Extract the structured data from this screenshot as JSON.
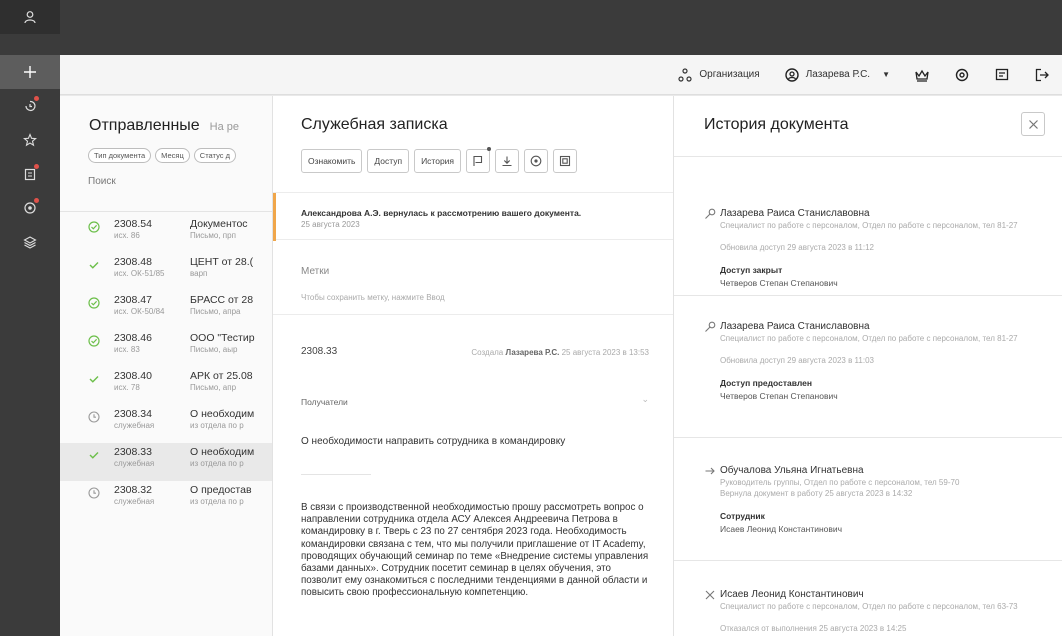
{
  "header": {
    "org": "Организация",
    "user": "Лазарева Р.С."
  },
  "list": {
    "title": "Отправленные",
    "title_extra": "На ре",
    "chips": [
      "Тип документа",
      "Месяц",
      "Статус д"
    ],
    "search": "Поиск",
    "rows": [
      {
        "status": "check-circle",
        "num": "2308.54",
        "sub": "исх. 86",
        "title": "Документос",
        "desc": "Письмо, прп"
      },
      {
        "status": "check",
        "num": "2308.48",
        "sub": "исх. ОК-51/85",
        "title": "ЦЕНТ от 28.(",
        "desc": "варп"
      },
      {
        "status": "check-circle",
        "num": "2308.47",
        "sub": "исх. ОК-50/84",
        "title": "БРАСС от 28",
        "desc": "Письмо, апра"
      },
      {
        "status": "check-circle",
        "num": "2308.46",
        "sub": "исх. 83",
        "title": "ООО \"Тестир",
        "desc": "Письмо, аыр"
      },
      {
        "status": "check",
        "num": "2308.40",
        "sub": "исх. 78",
        "title": "АРК от 25.08",
        "desc": "Письмо, апр"
      },
      {
        "status": "clock",
        "num": "2308.34",
        "sub": "служебная",
        "title": "О необходим",
        "desc": "из отдела по р"
      },
      {
        "status": "check",
        "num": "2308.33",
        "sub": "служебная",
        "title": "О необходим",
        "desc": "из отдела по р"
      },
      {
        "status": "clock",
        "num": "2308.32",
        "sub": "служебная",
        "title": "О предостав",
        "desc": "из отдела по р"
      }
    ]
  },
  "doc": {
    "title": "Служебная записка",
    "buttons": {
      "acquaint": "Ознакомить",
      "access": "Доступ",
      "history": "История"
    },
    "notice_title": "Александрова А.Э. вернулась к рассмотрению вашего документа.",
    "notice_date": "25 августа 2023",
    "tags_label": "Метки",
    "tags_hint": "Чтобы сохранить метку, нажмите Ввод",
    "number": "2308.33",
    "created_prefix": "Создала",
    "created_author": "Лазарева Р.С.",
    "created_date": "25 августа 2023 в 13:53",
    "recipients": "Получатели",
    "subject": "О необходимости направить сотрудника в командировку",
    "body": "В связи с производственной необходимостью прошу рассмотреть вопрос о направлении сотрудника отдела АСУ Алексея Андреевича Петрова в командировку в г. Тверь с 23 по 27 сентября 2023 года. Необходимость командировки связана с тем, что мы получили приглашение от IT Academy, проводящих обучающий семинар по теме «Внедрение системы управления базами данных». Сотрудник посетит семинар в целях обучения, это позволит ему ознакомиться с последними тенденциями в данной области и повысить свою профессиональную компетенцию."
  },
  "history": {
    "title": "История документа",
    "entries": [
      {
        "icon": "key",
        "name": "Лазарева Раиса Станиславовна",
        "position": "Специалист по работе с персоналом, Отдел по работе с персоналом, тел 81-27",
        "action": "Обновила доступ 29 августа 2023 в 11:12",
        "label": "Доступ закрыт",
        "value": "Четверов Степан Степанович"
      },
      {
        "icon": "key",
        "name": "Лазарева Раиса Станиславовна",
        "position": "Специалист по работе с персоналом, Отдел по работе с персоналом, тел 81-27",
        "action": "Обновила доступ 29 августа 2023 в 11:03",
        "label": "Доступ предоставлен",
        "value": "Четверов Степан Степанович"
      },
      {
        "icon": "arrow",
        "name": "Обучалова Ульяна Игнатьевна",
        "position": "Руководитель группы, Отдел по работе с персоналом, тел 59-70",
        "action": "Вернула документ в работу 25 августа 2023 в 14:32",
        "label": "Сотрудник",
        "value": "Исаев Леонид Константинович"
      },
      {
        "icon": "cross",
        "name": "Исаев Леонид Константинович",
        "position": "Специалист по работе с персоналом, Отдел по работе с персоналом, тел 63-73",
        "action": "Отказался от выполнения 25 августа 2023 в 14:25",
        "label": "",
        "value": ""
      }
    ]
  }
}
